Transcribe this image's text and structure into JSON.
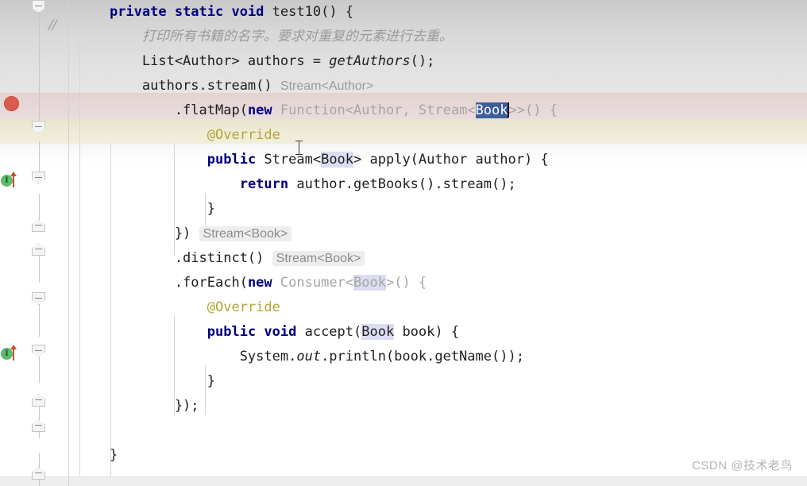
{
  "editor": {
    "language": "java",
    "watermark": "CSDN @技术老鸟",
    "colors": {
      "keyword": "#000080",
      "comment": "#9b9b9b",
      "annotation": "#b3a536",
      "ghost_text": "#a6a6a6",
      "selection_bg": "#3f5e9b",
      "template_var_bg": "#dcdcf2",
      "breakpoint": "#db5c4e",
      "breakpoint_line_bg": "#e7d8d8",
      "caret_line_bg": "#efebd6",
      "inlay_hint_bg": "#ededed",
      "impl_marker_green": "#5dbb6e",
      "impl_marker_arrow": "#c8502a"
    }
  },
  "gutter": {
    "comment_slashes": "//",
    "breakpoint_tooltip": "breakpoint",
    "impl_markers": [
      {
        "glyph": "I",
        "label": "implementing-method-marker"
      },
      {
        "glyph": "I",
        "label": "implementing-method-marker"
      }
    ]
  },
  "code": {
    "lines": [
      {
        "id": "line-method-signature",
        "segments": [
          {
            "text": "    ",
            "style": "plain"
          },
          {
            "text": "private static void ",
            "style": "kw"
          },
          {
            "text": "test10",
            "style": "plain"
          },
          {
            "text": "() {",
            "style": "plain"
          }
        ]
      },
      {
        "id": "line-comment",
        "segments": [
          {
            "text": "        ",
            "style": "plain"
          },
          {
            "text": "打印所有书籍的名字。要求对重复的元素进行去重。",
            "style": "cmt"
          }
        ]
      },
      {
        "id": "line-get-authors",
        "segments": [
          {
            "text": "        List<Author> authors = ",
            "style": "plain"
          },
          {
            "text": "getAuthors",
            "style": "meth-italic"
          },
          {
            "text": "();",
            "style": "plain"
          }
        ]
      },
      {
        "id": "line-authors-stream",
        "segments": [
          {
            "text": "        authors.stream()",
            "style": "plain"
          },
          {
            "text": " ",
            "style": "plain"
          },
          {
            "text": "Stream<Author>",
            "style": "hint-plain"
          }
        ]
      },
      {
        "id": "line-flatmap",
        "segments": [
          {
            "text": "            .flatMap(",
            "style": "plain"
          },
          {
            "text": "new",
            "style": "kw"
          },
          {
            "text": " ",
            "style": "plain"
          },
          {
            "text": "Function<Author, Stream<",
            "style": "ghost"
          },
          {
            "text": "Book",
            "style": "sel"
          },
          {
            "text": ">>() {",
            "style": "ghost"
          }
        ]
      },
      {
        "id": "line-override-1",
        "segments": [
          {
            "text": "                ",
            "style": "plain"
          },
          {
            "text": "@Override",
            "style": "anno"
          }
        ]
      },
      {
        "id": "line-apply",
        "segments": [
          {
            "text": "                ",
            "style": "plain"
          },
          {
            "text": "public",
            "style": "kw"
          },
          {
            "text": " Stream<",
            "style": "plain"
          },
          {
            "text": "Book",
            "style": "tmpl-var"
          },
          {
            "text": "> apply(Author author) {",
            "style": "plain"
          }
        ]
      },
      {
        "id": "line-return-stream",
        "segments": [
          {
            "text": "                    ",
            "style": "plain"
          },
          {
            "text": "return",
            "style": "kw"
          },
          {
            "text": " author.getBooks().stream();",
            "style": "plain"
          }
        ]
      },
      {
        "id": "line-close-apply",
        "segments": [
          {
            "text": "                }",
            "style": "plain"
          }
        ]
      },
      {
        "id": "line-close-flatmap",
        "segments": [
          {
            "text": "            })",
            "style": "plain"
          },
          {
            "text": " ",
            "style": "plain"
          },
          {
            "text": "Stream<Book>",
            "style": "hint"
          }
        ]
      },
      {
        "id": "line-distinct",
        "segments": [
          {
            "text": "            .distinct()",
            "style": "plain"
          },
          {
            "text": " ",
            "style": "plain"
          },
          {
            "text": "Stream<Book>",
            "style": "hint"
          }
        ]
      },
      {
        "id": "line-foreach",
        "segments": [
          {
            "text": "            .forEach(",
            "style": "plain"
          },
          {
            "text": "new",
            "style": "kw"
          },
          {
            "text": " ",
            "style": "plain"
          },
          {
            "text": "Consumer<",
            "style": "ghost"
          },
          {
            "text": "Book",
            "style": "ghost tmpl-var"
          },
          {
            "text": ">() {",
            "style": "ghost"
          }
        ]
      },
      {
        "id": "line-override-2",
        "segments": [
          {
            "text": "                ",
            "style": "plain"
          },
          {
            "text": "@Override",
            "style": "anno"
          }
        ]
      },
      {
        "id": "line-accept",
        "segments": [
          {
            "text": "                ",
            "style": "plain"
          },
          {
            "text": "public void",
            "style": "kw"
          },
          {
            "text": " accept(",
            "style": "plain"
          },
          {
            "text": "Book",
            "style": "tmpl-var"
          },
          {
            "text": " book) {",
            "style": "plain"
          }
        ]
      },
      {
        "id": "line-println",
        "segments": [
          {
            "text": "                    System.",
            "style": "plain"
          },
          {
            "text": "out",
            "style": "static-italic"
          },
          {
            "text": ".println(book.getName());",
            "style": "plain"
          }
        ]
      },
      {
        "id": "line-close-accept",
        "segments": [
          {
            "text": "                }",
            "style": "plain"
          }
        ]
      },
      {
        "id": "line-close-foreach",
        "segments": [
          {
            "text": "            });",
            "style": "plain"
          }
        ]
      },
      {
        "id": "line-blank",
        "segments": []
      },
      {
        "id": "line-close-method",
        "segments": [
          {
            "text": "    }",
            "style": "plain"
          }
        ]
      }
    ]
  }
}
